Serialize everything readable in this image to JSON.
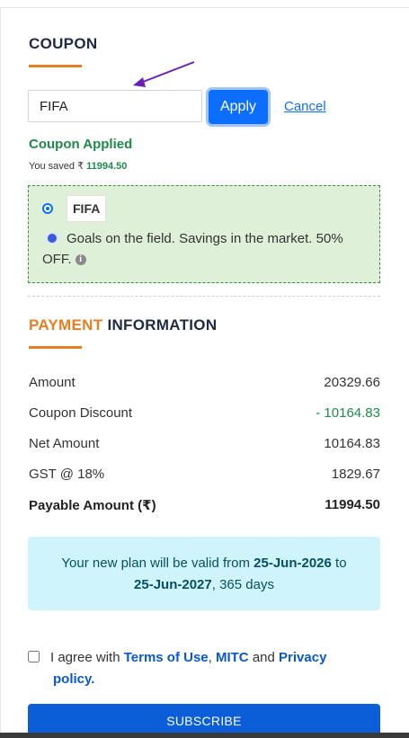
{
  "coupon": {
    "title": "COUPON",
    "input_value": "FIFA",
    "apply_label": "Apply",
    "cancel_label": "Cancel",
    "status": "Coupon Applied",
    "saved_prefix": "You saved ₹",
    "saved_amount": "11994.50",
    "option": {
      "code": "FIFA",
      "description": "Goals on the field. Savings in the market. 50% OFF.",
      "selected": true
    }
  },
  "payment": {
    "title_highlight": "PAYMENT",
    "title_rest": "INFORMATION",
    "rows": [
      {
        "label": "Amount",
        "value": "20329.66"
      },
      {
        "label": "Coupon Discount",
        "value": "- 10164.83"
      },
      {
        "label": "Net Amount",
        "value": "10164.83"
      },
      {
        "label": "GST @ 18%",
        "value": "1829.67"
      },
      {
        "label": "Payable Amount (₹)",
        "value": "11994.50"
      }
    ]
  },
  "validity": {
    "prefix": "Your new plan will be valid from",
    "from": "25-Jun-2026",
    "to_word": "to",
    "to": "25-Jun-2027",
    "suffix": ", 365 days"
  },
  "agreement": {
    "checked": false,
    "prefix": "I agree with",
    "terms": "Terms of Use",
    "comma": ",",
    "mitc": "MITC",
    "and": "and",
    "privacy_1": "Privacy",
    "privacy_2": "policy."
  },
  "subscribe_label": "SUBSCRIBE",
  "colors": {
    "accent": "#0d6efd",
    "underline": "#e67e22",
    "success": "#1e8a4a",
    "coupon_bg": "#dff0d8",
    "info_bg": "#cff4fc",
    "arrow": "#6a1fb8"
  },
  "icons": {
    "annotation": "arrow-icon",
    "coupon_option": "soccer-ball-icon",
    "info": "info-icon"
  }
}
